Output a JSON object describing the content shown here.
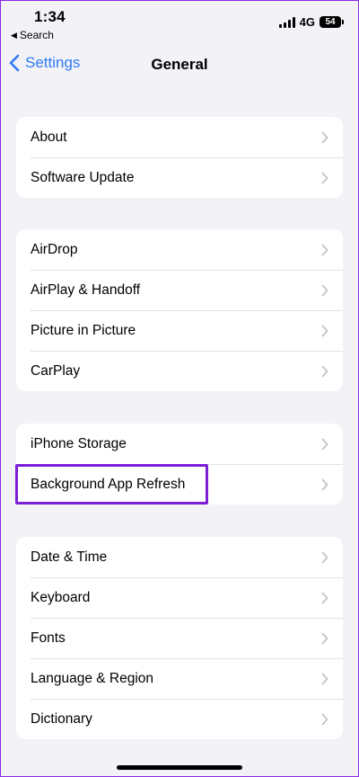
{
  "status_bar": {
    "time": "1:34",
    "back_app_label": "Search",
    "network": "4G",
    "battery": "54"
  },
  "nav": {
    "back_label": "Settings",
    "title": "General"
  },
  "groups": [
    {
      "items": [
        {
          "label": "About"
        },
        {
          "label": "Software Update"
        }
      ]
    },
    {
      "items": [
        {
          "label": "AirDrop"
        },
        {
          "label": "AirPlay & Handoff"
        },
        {
          "label": "Picture in Picture"
        },
        {
          "label": "CarPlay"
        }
      ]
    },
    {
      "items": [
        {
          "label": "iPhone Storage"
        },
        {
          "label": "Background App Refresh"
        }
      ]
    },
    {
      "items": [
        {
          "label": "Date & Time"
        },
        {
          "label": "Keyboard"
        },
        {
          "label": "Fonts"
        },
        {
          "label": "Language & Region"
        },
        {
          "label": "Dictionary"
        }
      ]
    }
  ],
  "highlighted_item": "Background App Refresh",
  "colors": {
    "accent": "#2f7bf5",
    "highlight": "#7d1ed9",
    "background": "#f2f2f7",
    "chevron": "#c4c4c8"
  }
}
